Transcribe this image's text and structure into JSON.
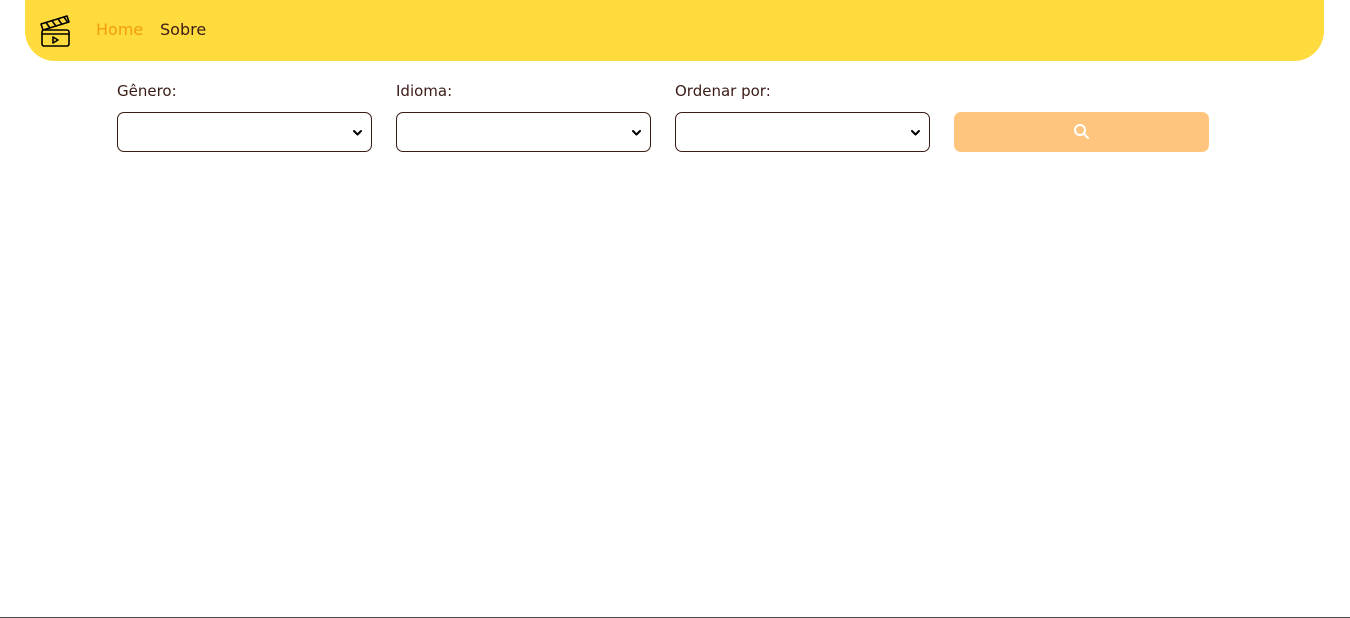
{
  "navbar": {
    "logo_icon": "film-clapperboard-icon",
    "links": [
      {
        "label": "Home",
        "active": true,
        "color": "#f39c12"
      },
      {
        "label": "Sobre",
        "active": false,
        "color": "#3a1b16"
      }
    ],
    "background": "#ffdb3d"
  },
  "filters": {
    "genre": {
      "label": "Gênero:",
      "selected": ""
    },
    "language": {
      "label": "Idioma:",
      "selected": ""
    },
    "sort": {
      "label": "Ordenar por:",
      "selected": ""
    }
  },
  "search_button": {
    "icon": "search-icon",
    "background": "#ffc57f"
  },
  "colors": {
    "text": "#3a1b16",
    "accent": "#f39c12"
  }
}
